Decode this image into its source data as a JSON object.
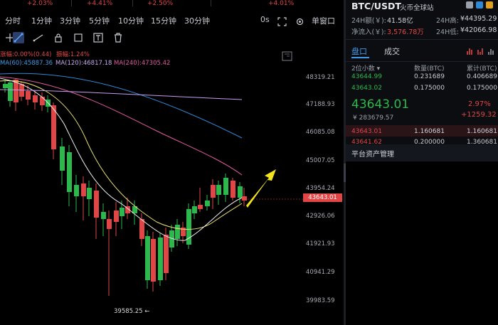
{
  "tickers": [
    "+2.03%",
    "+4.41%",
    "+2.50%",
    "+4.01%"
  ],
  "timeframes": [
    "分时",
    "1分钟",
    "3分钟",
    "5分钟",
    "10分钟",
    "15分钟",
    "30分钟"
  ],
  "timeframe_active": "1分钟",
  "interval_right": "0s",
  "single_window": "单窗口",
  "indicators": {
    "change": "涨幅:0.00%(0.44)",
    "amplitude": "振幅:1.24%",
    "ma60": "MA(60):45887.36",
    "ma120": "MA(120):46817.18",
    "ma240": "MA(240):47305.42"
  },
  "price_labels": [
    "48319.21",
    "47188.93",
    "46085.08",
    "45007.05",
    "43954.24",
    "42926.06",
    "41921.93",
    "40941.29",
    "39983.59"
  ],
  "current_price_label": "43643.01",
  "low_marker": "39585.25",
  "colors": {
    "up": "#2db84d",
    "down": "#e14646",
    "ma_short": "#e8e070",
    "ma_mid": "#f0f0f0",
    "ma60": "#2e89d6",
    "ma120": "#c89bf0",
    "ma240": "#e05aa0",
    "arrow": "#f2e41c"
  },
  "right": {
    "symbol": "BTC/USDT",
    "exchange": "火币全球站",
    "vol_label": "24H额(￥):",
    "vol_value": "41.58亿",
    "high_label": "24H高:",
    "high_value": "¥44395.29",
    "inflow_label": "净流入(￥):",
    "inflow_value": "3,576.78万",
    "low_label": "24H低:",
    "low_value": "¥42066.98",
    "tabs": [
      "盘口",
      "成交"
    ],
    "tab_active": "盘口",
    "col_headers": [
      "2位小数",
      "数量(BTC)",
      "累计(BTC)"
    ],
    "asks": [
      {
        "price": "43644.99",
        "qty": "0.231689",
        "total": "0.406689"
      },
      {
        "price": "43643.02",
        "qty": "0.175000",
        "total": "0.175000"
      }
    ],
    "last_price": "43643.01",
    "last_cny": "¥ 283679.57",
    "change_pct": "2.97%",
    "change_abs": "+1259.32",
    "bids": [
      {
        "price": "43643.01",
        "qty": "1.160681",
        "total": "1.160681"
      },
      {
        "price": "43641.62",
        "qty": "0.200000",
        "total": "1.360681"
      }
    ],
    "asset_mgmt": "平台资产管理"
  }
}
